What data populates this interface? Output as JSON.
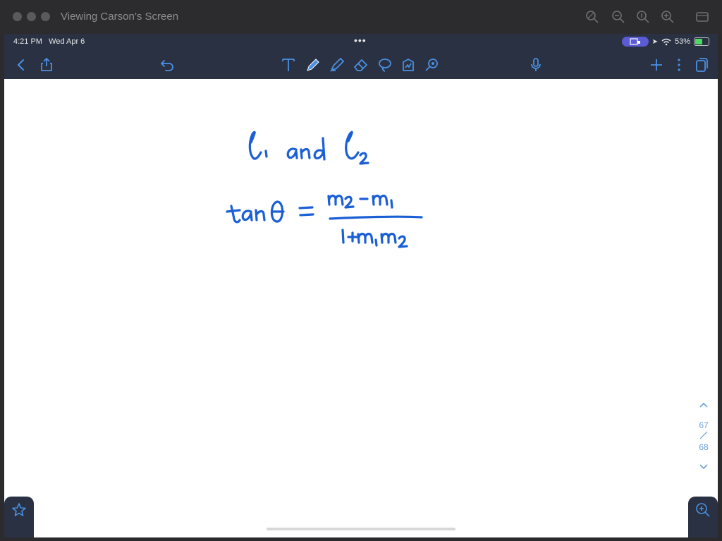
{
  "window": {
    "title": "Viewing Carson’s Screen"
  },
  "status_bar": {
    "time": "4:21 PM",
    "date": "Wed Apr 6",
    "battery": "53%",
    "battery_level": 0.53
  },
  "toolbar": {
    "left": [
      "back-icon",
      "share-icon"
    ],
    "undo": "undo-icon",
    "tools": [
      "text-tool-icon",
      "pen-tool-icon",
      "highlighter-tool-icon",
      "eraser-tool-icon",
      "lasso-tool-icon",
      "image-tool-icon",
      "elements-tool-icon"
    ],
    "right": [
      "microphone-icon",
      "plus-icon",
      "more-icon",
      "pages-icon"
    ]
  },
  "note": {
    "handwriting": {
      "line1": "l₁ and l₂",
      "line2_lhs": "tanθ =",
      "numerator": "m₂ − m₁",
      "denominator": "1 + m₁m₂"
    },
    "ink_color": "#1a5fd6"
  },
  "pager": {
    "current": "67",
    "total": "68"
  },
  "colors": {
    "toolbar_bg": "#2a3142",
    "accent": "#4a90e2"
  }
}
